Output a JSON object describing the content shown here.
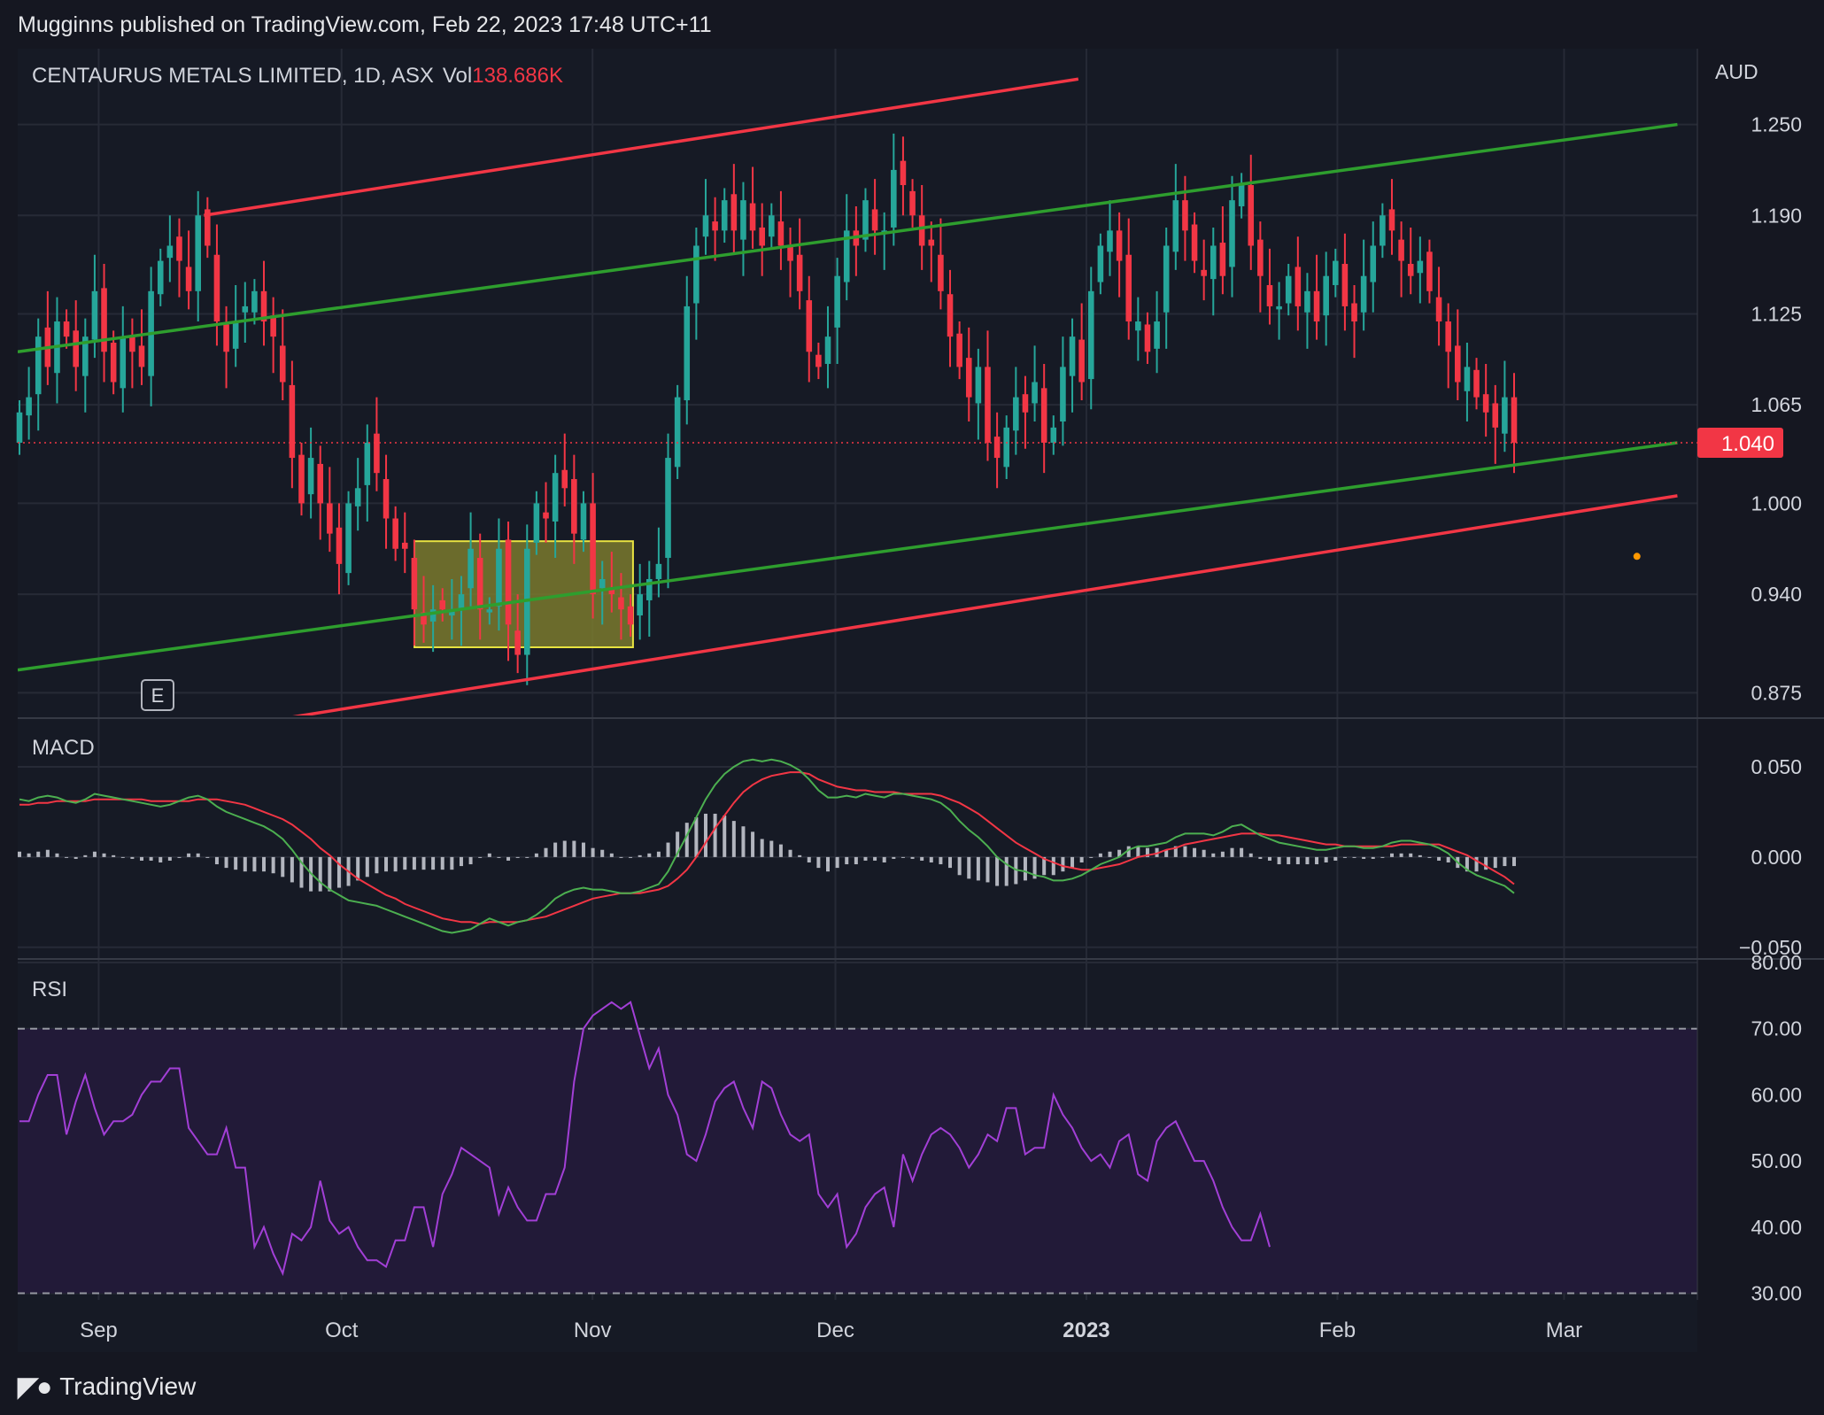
{
  "header": {
    "text": "Mugginns published on TradingView.com, Feb 22, 2023 17:48 UTC+11"
  },
  "footer": {
    "brand": "TradingView",
    "logo_icon": "tradingview-logo-icon"
  },
  "colors": {
    "background": "#151721",
    "panel": "#161a25",
    "grid": "#262a36",
    "up": "#26a69a",
    "down": "#f23645",
    "green_channel": "#2e9e2e",
    "red_channel": "#f23645",
    "macd_line": "#4caf50",
    "signal_line": "#f23645",
    "histogram": "#b2b5be",
    "rsi_line": "#a23fd6",
    "rsi_band": "#221a38",
    "zone_fill": "#7a7a2e",
    "zone_border": "#e8e341"
  },
  "chart_data": [
    {
      "type": "candlestick",
      "title": "CENTAURUS METALS LIMITED, 1D, ASX",
      "volume_label": "Vol",
      "volume_value": "138.686K",
      "currency": "AUD",
      "y_ticks": [
        "1.250",
        "1.190",
        "1.125",
        "1.065",
        "1.000",
        "0.940",
        "0.875"
      ],
      "ylim": [
        0.86,
        1.3
      ],
      "last_price": "1.040",
      "earnings_marker": "E",
      "x_axis": {
        "ticks": [
          "Sep",
          "Oct",
          "Nov",
          "Dec",
          "2023",
          "Feb",
          "Mar"
        ],
        "dates": [
          "2022-09-01",
          "2022-10-01",
          "2022-11-01",
          "2022-12-01",
          "2023-01-01",
          "2023-02-01",
          "2023-03-01"
        ]
      },
      "close": [
        1.06,
        1.07,
        1.11,
        1.09,
        1.12,
        1.11,
        1.09,
        1.11,
        1.14,
        1.1,
        1.08,
        1.11,
        1.1,
        1.09,
        1.14,
        1.16,
        1.17,
        1.16,
        1.14,
        1.19,
        1.17,
        1.12,
        1.1,
        1.12,
        1.13,
        1.14,
        1.12,
        1.11,
        1.08,
        1.03,
        1.0,
        1.03,
        1.0,
        0.98,
        0.96,
        1.0,
        1.01,
        1.04,
        1.02,
        0.99,
        0.97,
        0.97,
        0.93,
        0.92,
        0.93,
        0.93,
        0.93,
        0.94,
        0.97,
        0.93,
        0.93,
        0.97,
        0.92,
        0.9,
        0.97,
        1.0,
        0.99,
        1.02,
        1.01,
        0.98,
        1.0,
        0.94,
        0.95,
        0.94,
        0.93,
        0.92,
        0.94,
        0.95,
        0.96,
        1.03,
        1.07,
        1.13,
        1.17,
        1.19,
        1.18,
        1.2,
        1.18,
        1.2,
        1.18,
        1.17,
        1.19,
        1.17,
        1.16,
        1.14,
        1.1,
        1.09,
        1.11,
        1.15,
        1.18,
        1.17,
        1.2,
        1.18,
        1.18,
        1.22,
        1.21,
        1.19,
        1.17,
        1.17,
        1.14,
        1.11,
        1.09,
        1.07,
        1.09,
        1.04,
        1.03,
        1.05,
        1.07,
        1.06,
        1.08,
        1.04,
        1.05,
        1.09,
        1.11,
        1.08,
        1.14,
        1.17,
        1.18,
        1.16,
        1.12,
        1.12,
        1.1,
        1.12,
        1.17,
        1.2,
        1.18,
        1.16,
        1.15,
        1.17,
        1.15,
        1.2,
        1.21,
        1.17,
        1.15,
        1.13,
        1.13,
        1.15,
        1.13,
        1.14,
        1.12,
        1.15,
        1.16,
        1.13,
        1.12,
        1.15,
        1.17,
        1.19,
        1.18,
        1.16,
        1.15,
        1.16,
        1.14,
        1.12,
        1.1,
        1.08,
        1.09,
        1.07,
        1.06,
        1.05,
        1.07,
        1.04
      ],
      "price_channels": [
        {
          "name": "",
          "color": "red",
          "points": [
            [
              "2022-09-14",
              1.19
            ],
            [
              "2022-12-31",
              1.28
            ]
          ]
        },
        {
          "name": "",
          "color": "green",
          "points": [
            [
              "2022-08-22",
              1.1
            ],
            [
              "2023-03-15",
              1.25
            ]
          ]
        },
        {
          "name": "",
          "color": "green",
          "points": [
            [
              "2022-08-22",
              0.89
            ],
            [
              "2023-03-15",
              1.04
            ]
          ]
        },
        {
          "name": "",
          "color": "red",
          "points": [
            [
              "2022-08-22",
              0.83
            ],
            [
              "2023-03-15",
              1.005
            ]
          ]
        }
      ],
      "highlight_zone": {
        "from": "2022-10-10",
        "to": "2022-11-06",
        "top": 0.975,
        "bottom": 0.905
      },
      "marker_dot": {
        "date": "2023-03-10",
        "value": 0.965
      }
    },
    {
      "type": "line",
      "title": "MACD",
      "y_ticks": [
        "0.050",
        "0.000",
        "−0.050"
      ],
      "ylim": [
        -0.055,
        0.075
      ],
      "series_macd": [
        0.032,
        0.031,
        0.033,
        0.034,
        0.033,
        0.031,
        0.03,
        0.032,
        0.035,
        0.034,
        0.033,
        0.032,
        0.031,
        0.03,
        0.029,
        0.028,
        0.029,
        0.031,
        0.033,
        0.034,
        0.032,
        0.028,
        0.025,
        0.023,
        0.021,
        0.019,
        0.017,
        0.014,
        0.01,
        0.004,
        -0.003,
        -0.009,
        -0.014,
        -0.018,
        -0.021,
        -0.024,
        -0.025,
        -0.026,
        -0.027,
        -0.029,
        -0.031,
        -0.033,
        -0.035,
        -0.037,
        -0.039,
        -0.041,
        -0.042,
        -0.041,
        -0.04,
        -0.037,
        -0.034,
        -0.036,
        -0.038,
        -0.036,
        -0.035,
        -0.032,
        -0.028,
        -0.023,
        -0.02,
        -0.018,
        -0.017,
        -0.018,
        -0.018,
        -0.019,
        -0.02,
        -0.02,
        -0.019,
        -0.017,
        -0.015,
        -0.008,
        0.002,
        0.012,
        0.022,
        0.032,
        0.04,
        0.046,
        0.05,
        0.053,
        0.054,
        0.053,
        0.054,
        0.053,
        0.051,
        0.048,
        0.043,
        0.037,
        0.033,
        0.033,
        0.034,
        0.033,
        0.035,
        0.034,
        0.033,
        0.035,
        0.035,
        0.034,
        0.033,
        0.032,
        0.03,
        0.026,
        0.02,
        0.015,
        0.011,
        0.006,
        0.0,
        -0.004,
        -0.007,
        -0.008,
        -0.01,
        -0.011,
        -0.013,
        -0.013,
        -0.012,
        -0.01,
        -0.007,
        -0.004,
        -0.002,
        0.0,
        0.004,
        0.006,
        0.006,
        0.007,
        0.008,
        0.011,
        0.013,
        0.013,
        0.013,
        0.012,
        0.014,
        0.017,
        0.018,
        0.015,
        0.012,
        0.01,
        0.008,
        0.007,
        0.006,
        0.005,
        0.004,
        0.004,
        0.005,
        0.006,
        0.006,
        0.005,
        0.005,
        0.006,
        0.008,
        0.009,
        0.009,
        0.008,
        0.007,
        0.005,
        0.002,
        -0.003,
        -0.007,
        -0.01,
        -0.012,
        -0.014,
        -0.016,
        -0.02
      ],
      "series_signal": [
        0.029,
        0.029,
        0.03,
        0.03,
        0.031,
        0.031,
        0.031,
        0.031,
        0.032,
        0.032,
        0.032,
        0.032,
        0.032,
        0.032,
        0.031,
        0.031,
        0.031,
        0.031,
        0.031,
        0.032,
        0.032,
        0.032,
        0.031,
        0.03,
        0.029,
        0.027,
        0.025,
        0.023,
        0.021,
        0.018,
        0.014,
        0.01,
        0.005,
        0.001,
        -0.004,
        -0.008,
        -0.012,
        -0.015,
        -0.018,
        -0.021,
        -0.023,
        -0.026,
        -0.028,
        -0.03,
        -0.032,
        -0.034,
        -0.035,
        -0.036,
        -0.036,
        -0.037,
        -0.036,
        -0.036,
        -0.036,
        -0.036,
        -0.035,
        -0.034,
        -0.033,
        -0.031,
        -0.029,
        -0.027,
        -0.025,
        -0.023,
        -0.022,
        -0.021,
        -0.02,
        -0.02,
        -0.02,
        -0.019,
        -0.018,
        -0.016,
        -0.012,
        -0.007,
        0.0,
        0.008,
        0.016,
        0.023,
        0.03,
        0.036,
        0.04,
        0.043,
        0.045,
        0.046,
        0.047,
        0.047,
        0.046,
        0.043,
        0.041,
        0.039,
        0.038,
        0.037,
        0.037,
        0.036,
        0.036,
        0.036,
        0.035,
        0.035,
        0.035,
        0.035,
        0.034,
        0.032,
        0.03,
        0.027,
        0.024,
        0.02,
        0.016,
        0.012,
        0.008,
        0.005,
        0.002,
        -0.001,
        -0.003,
        -0.005,
        -0.006,
        -0.007,
        -0.007,
        -0.006,
        -0.005,
        -0.004,
        -0.002,
        0.0,
        0.001,
        0.002,
        0.004,
        0.005,
        0.007,
        0.008,
        0.009,
        0.01,
        0.011,
        0.012,
        0.013,
        0.013,
        0.013,
        0.012,
        0.012,
        0.011,
        0.01,
        0.009,
        0.008,
        0.007,
        0.007,
        0.006,
        0.006,
        0.006,
        0.006,
        0.006,
        0.006,
        0.007,
        0.007,
        0.007,
        0.007,
        0.007,
        0.005,
        0.003,
        0.001,
        -0.002,
        -0.005,
        -0.008,
        -0.011,
        -0.015
      ]
    },
    {
      "type": "line",
      "title": "RSI",
      "y_ticks": [
        "80.00",
        "70.00",
        "60.00",
        "50.00",
        "40.00",
        "30.00"
      ],
      "ylim": [
        29,
        80
      ],
      "band": [
        30,
        70
      ],
      "values": [
        56,
        56,
        60,
        63,
        63,
        54,
        59,
        63,
        58,
        54,
        56,
        56,
        57,
        60,
        62,
        62,
        64,
        64,
        55,
        53,
        51,
        51,
        55,
        49,
        49,
        37,
        40,
        36,
        33,
        39,
        38,
        40,
        47,
        41,
        39,
        40,
        37,
        35,
        35,
        34,
        38,
        38,
        43,
        43,
        37,
        45,
        48,
        52,
        51,
        50,
        49,
        42,
        46,
        43,
        41,
        41,
        45,
        45,
        49,
        62,
        70,
        72,
        73,
        74,
        73,
        74,
        69,
        64,
        67,
        60,
        57,
        51,
        50,
        54,
        59,
        61,
        62,
        58,
        55,
        62,
        61,
        57,
        54,
        53,
        54,
        45,
        43,
        45,
        37,
        39,
        43,
        45,
        46,
        40,
        51,
        47,
        51,
        54,
        55,
        54,
        52,
        49,
        51,
        54,
        53,
        58,
        58,
        51,
        52,
        52,
        60,
        57,
        55,
        52,
        50,
        51,
        49,
        53,
        54,
        48,
        47,
        53,
        55,
        56,
        53,
        50,
        50,
        47,
        43,
        40,
        38,
        38,
        42,
        37
      ]
    }
  ]
}
